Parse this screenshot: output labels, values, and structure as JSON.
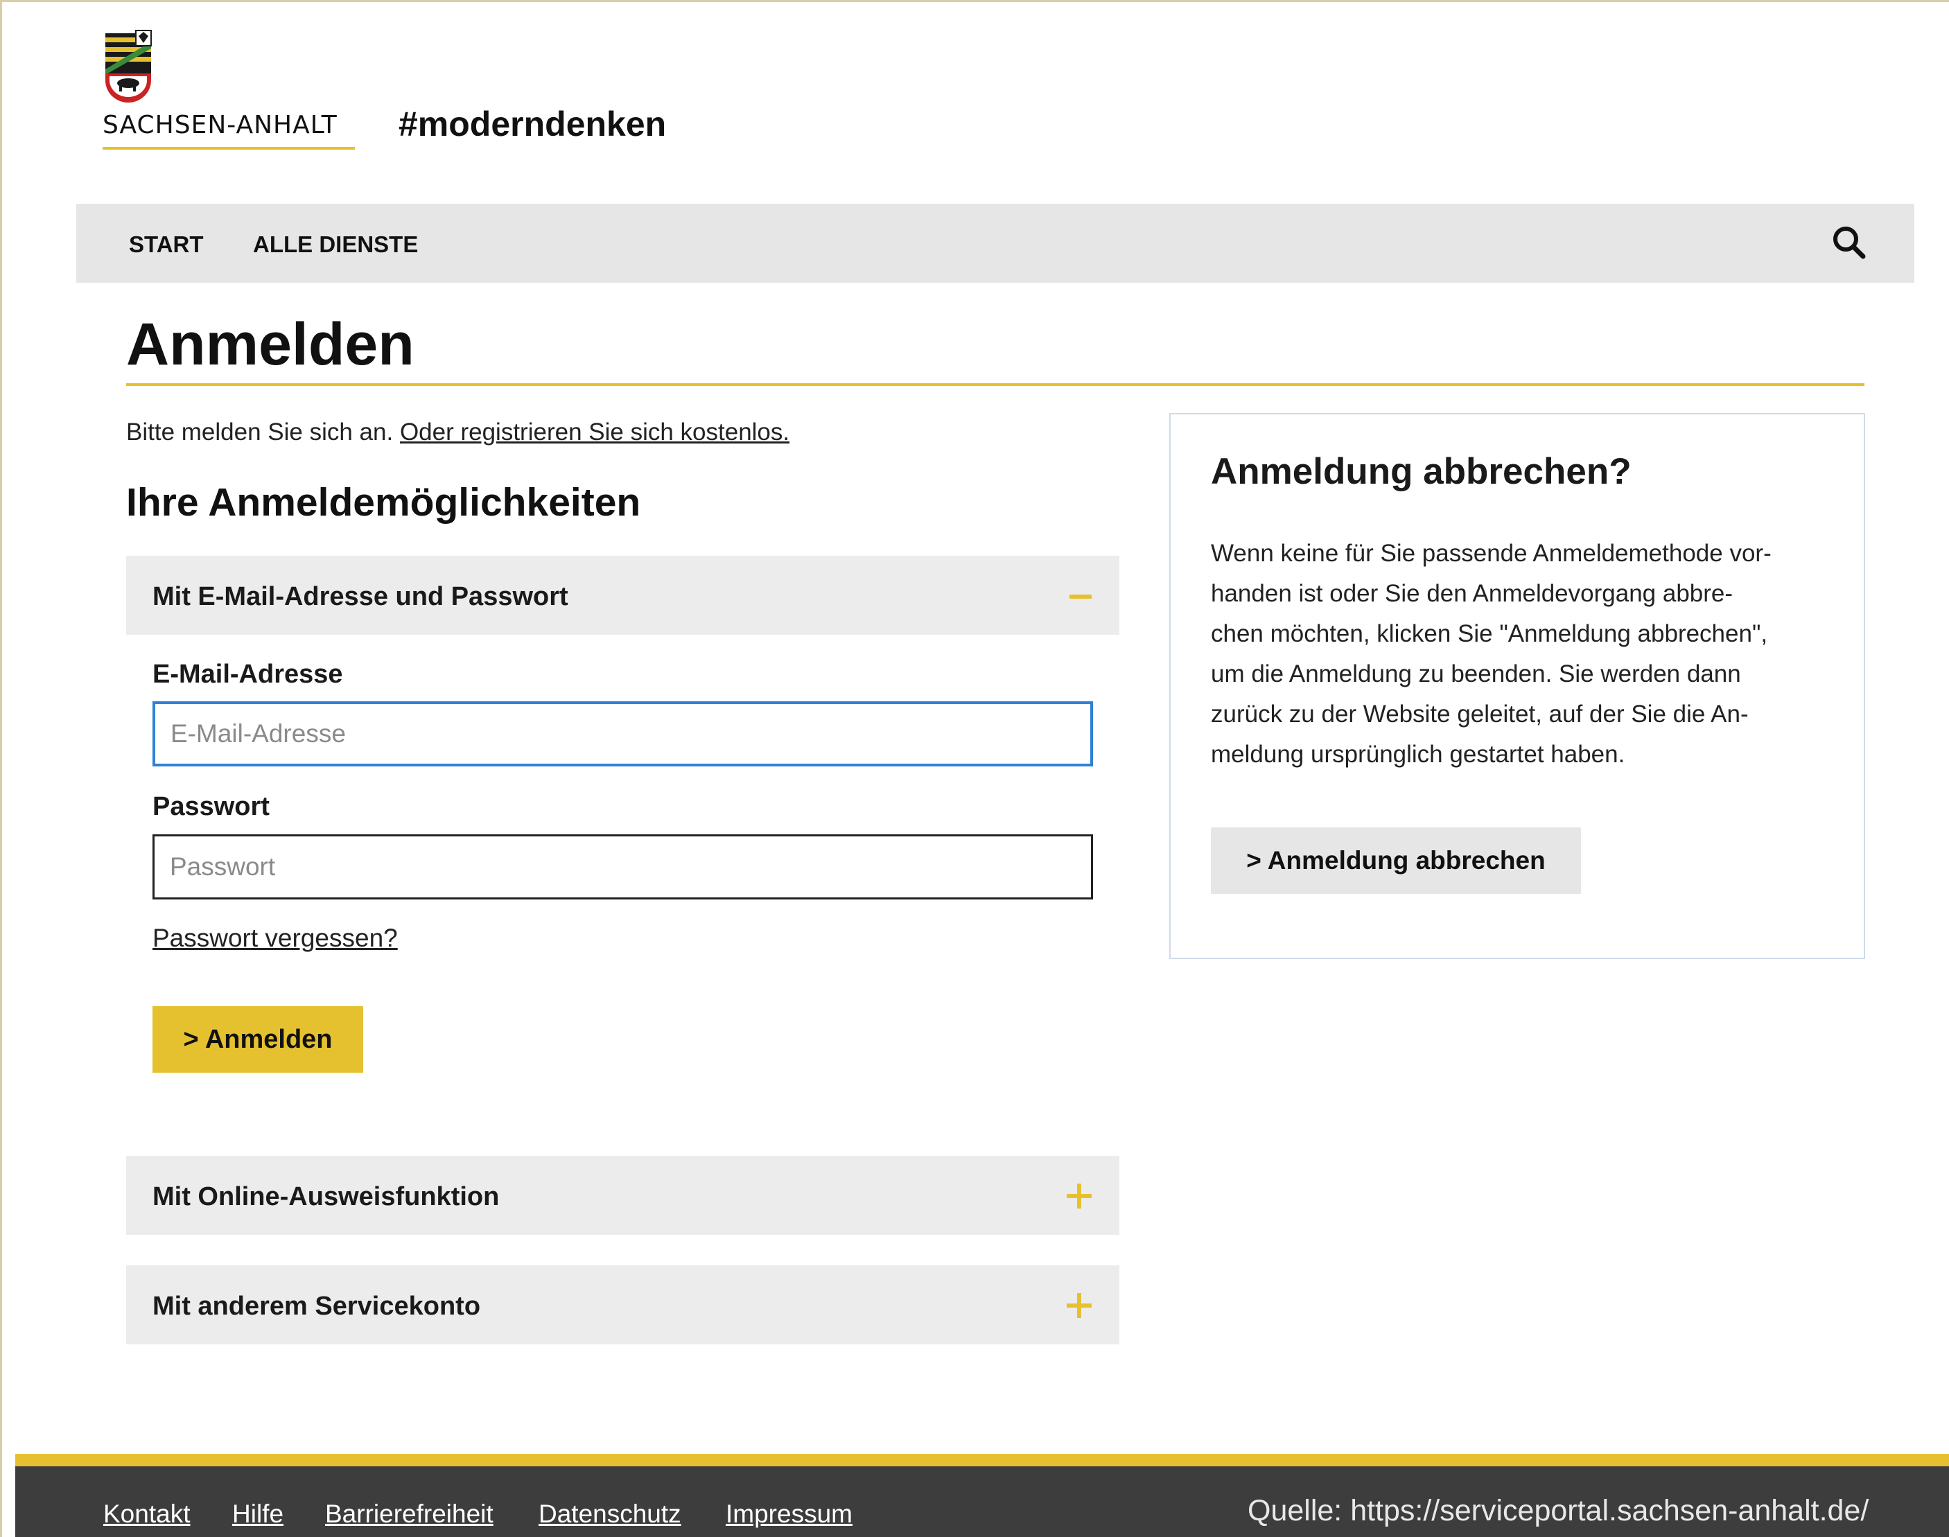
{
  "header": {
    "state_name": "SACHSEN-ANHALT",
    "hashtag": "#moderndenken"
  },
  "nav": {
    "items": [
      {
        "label": "START"
      },
      {
        "label": "ALLE DIENSTE"
      }
    ],
    "search_icon": "search-icon"
  },
  "page": {
    "title": "Anmelden",
    "intro_text": "Bitte melden Sie sich an. ",
    "register_link": "Oder registrieren Sie sich kostenlos.",
    "options_heading": "Ihre Anmeldemöglichkeiten"
  },
  "accordion": {
    "email": {
      "title": "Mit E-Mail-Adresse und Passwort",
      "state_icon": "minus-icon",
      "email_label": "E-Mail-Adresse",
      "email_placeholder": "E-Mail-Adresse",
      "password_label": "Passwort",
      "password_placeholder": "Passwort",
      "forgot_link": "Passwort vergessen?",
      "submit_label": "> Anmelden"
    },
    "eid": {
      "title": "Mit Online-Ausweisfunktion",
      "state_icon": "plus-icon"
    },
    "other": {
      "title": "Mit anderem Servicekonto",
      "state_icon": "plus-icon"
    }
  },
  "cancel_panel": {
    "heading": "Anmeldung abbrechen?",
    "lines": [
      "Wenn keine für Sie passende Anmeldemethode vor-",
      "handen ist oder Sie den Anmeldevorgang abbre-",
      "chen möchten, klicken Sie \"Anmeldung abbrechen\",",
      "um die Anmeldung zu beenden. Sie werden dann",
      "zurück zu der Website geleitet, auf der Sie die An-",
      "meldung ursprünglich gestartet haben."
    ],
    "button_label": "> Anmeldung abbrechen"
  },
  "footer": {
    "links": [
      {
        "label": "Kontakt"
      },
      {
        "label": "Hilfe"
      },
      {
        "label": "Barrierefreiheit"
      },
      {
        "label": "Datenschutz"
      },
      {
        "label": "Impressum"
      }
    ],
    "source": "Quelle: https://serviceportal.sachsen-anhalt.de/"
  },
  "colors": {
    "accent_yellow": "#e6c12f",
    "nav_gray": "#e6e6e6",
    "footer_dark": "#3d3d3d",
    "focus_blue": "#2f82d6"
  }
}
